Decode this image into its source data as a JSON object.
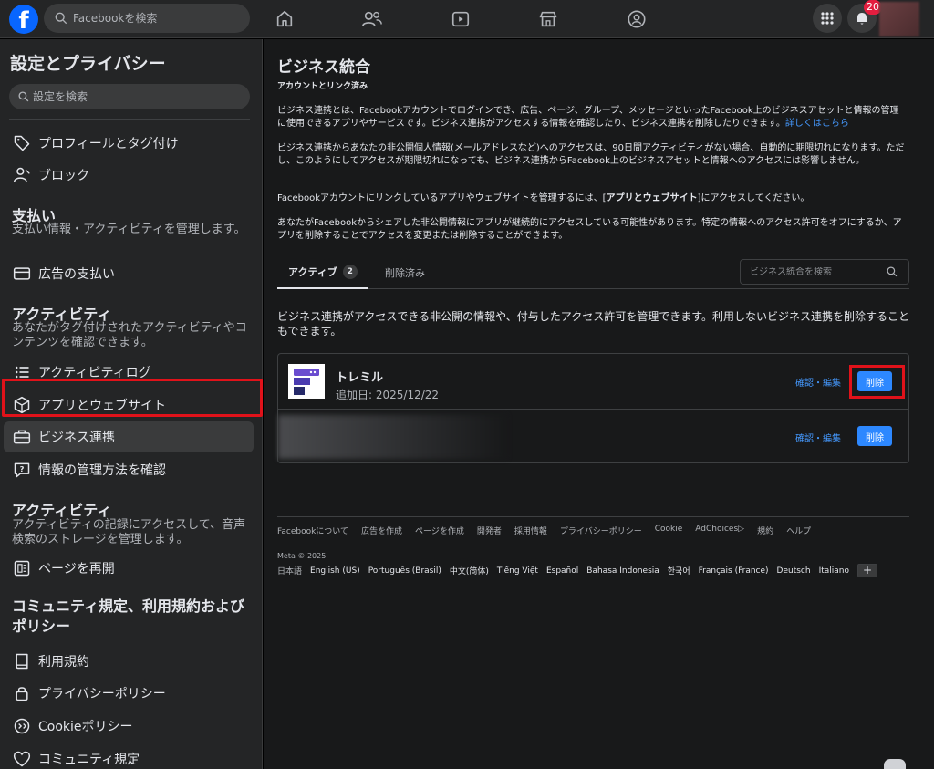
{
  "topbar": {
    "logo": "f",
    "search_placeholder": "Facebookを検索",
    "nav_icons": [
      "home-icon",
      "friends-icon",
      "video-icon",
      "marketplace-icon",
      "groups-icon"
    ],
    "notification_count": "20"
  },
  "sidebar": {
    "title": "設定とプライバシー",
    "search_placeholder": "設定を検索",
    "items": [
      {
        "label": "プロフィールとタグ付け",
        "icon": "tag-icon"
      },
      {
        "label": "ブロック",
        "icon": "block-user-icon"
      },
      {
        "label": "広告の支払い",
        "icon": "credit-card-icon"
      },
      {
        "label": "アクティビティログ",
        "icon": "list-icon"
      },
      {
        "label": "アプリとウェブサイト",
        "icon": "cube-icon"
      },
      {
        "label": "ビジネス連携",
        "icon": "briefcase-icon"
      },
      {
        "label": "情報の管理方法を確認",
        "icon": "question-icon"
      },
      {
        "label": "ページを再開",
        "icon": "page-icon"
      },
      {
        "label": "利用規約",
        "icon": "book-icon"
      },
      {
        "label": "プライバシーポリシー",
        "icon": "lock-icon"
      },
      {
        "label": "Cookieポリシー",
        "icon": "cookie-icon"
      },
      {
        "label": "コミュニティ規定",
        "icon": "community-icon"
      }
    ],
    "sections": [
      {
        "title": "支払い",
        "desc": "支払い情報・アクティビティを管理します。"
      },
      {
        "title": "アクティビティ",
        "desc": "あなたがタグ付けされたアクティビティやコンテンツを確認できます。"
      },
      {
        "title": "アクティビティ",
        "desc": "アクティビティの記録にアクセスして、音声検索のストレージを管理します。"
      },
      {
        "title": "コミュニティ規定、利用規約およびポリシー",
        "desc": ""
      }
    ]
  },
  "main": {
    "title": "ビジネス統合",
    "subtitle": "アカウントとリンク済み",
    "para1": "ビジネス連携とは、Facebookアカウントでログインでき、広告、ページ、グループ、メッセージといったFacebook上のビジネスアセットと情報の管理に使用できるアプリやサービスです。ビジネス連携がアクセスする情報を確認したり、ビジネス連携を削除したりできます。",
    "para1_link": "詳しくはこちら",
    "para2": "ビジネス連携からあなたの非公開個人情報(メールアドレスなど)へのアクセスは、90日間アクティビティがない場合、自動的に期限切れになります。ただし、このようにしてアクセスが期限切れになっても、ビジネス連携からFacebook上のビジネスアセットと情報へのアクセスには影響しません。",
    "para3_pre": "Facebookアカウントにリンクしているアプリやウェブサイトを管理するには、[",
    "para3_link": "アプリとウェブサイト",
    "para3_post": "]にアクセスしてください。",
    "para4": "あなたがFacebookからシェアした非公開情報にアプリが継続的にアクセスしている可能性があります。特定の情報へのアクセス許可をオフにするか、アプリを削除することでアクセスを変更または削除することができます。",
    "tabs": {
      "active": "アクティブ",
      "active_count": "2",
      "removed": "削除済み"
    },
    "biz_search_placeholder": "ビジネス統合を検索",
    "list_desc": "ビジネス連携がアクセスできる非公開の情報や、付与したアクセス許可を管理できます。利用しないビジネス連携を削除することもできます。",
    "integrations": [
      {
        "name": "トレミル",
        "added": "追加日: 2025/12/22",
        "edit_label": "確認・編集",
        "delete_label": "削除"
      },
      {
        "name": "",
        "added": "",
        "edit_label": "確認・編集",
        "delete_label": "削除"
      }
    ]
  },
  "footer": {
    "links": [
      "Facebookについて",
      "広告を作成",
      "ページを作成",
      "開発者",
      "採用情報",
      "プライバシーポリシー",
      "Cookie",
      "AdChoices▷",
      "規約",
      "ヘルプ"
    ],
    "copyright": "Meta © 2025",
    "current_language": "日本語",
    "languages": [
      "English (US)",
      "Português (Brasil)",
      "中文(简体)",
      "Tiếng Việt",
      "Español",
      "Bahasa Indonesia",
      "한국어",
      "Français (France)",
      "Deutsch",
      "Italiano"
    ],
    "add_language": "+"
  }
}
